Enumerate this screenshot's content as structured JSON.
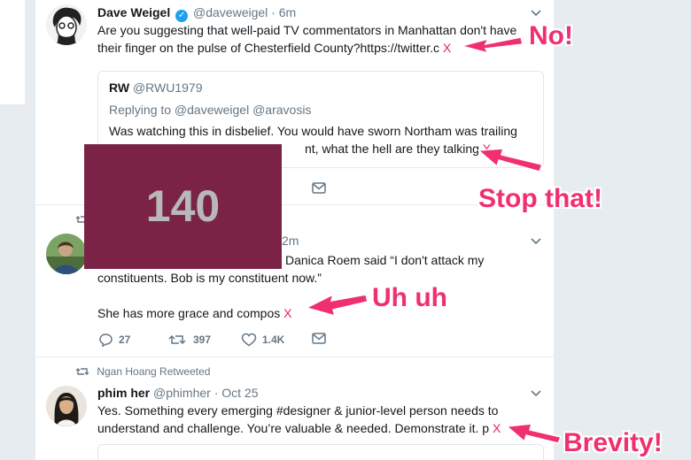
{
  "tweets": [
    {
      "name": "Dave Weigel",
      "handle": "@daveweigel",
      "time": "6m",
      "line1": "Are you suggesting that well-paid TV commentators in Manhattan don't have",
      "line2": "their finger on the pulse of Chesterfield County?https://twitter.c",
      "x": "X",
      "quote": {
        "name": "RW",
        "handle": "@RWU1979",
        "replying": "Replying to @daveweigel @aravosis",
        "line1": "Was watching this in disbelief. You would have sworn Northam was trailing",
        "line2_tail": "nt, what the hell are they talking",
        "x": "X"
      }
    },
    {
      "time_partial": "2m",
      "line1_tail": "Danica Roem said “I don't attack my",
      "line2": "constituents. Bob is my constituent now.”",
      "line3": "She has more grace and compos",
      "x": "X",
      "replies": "27",
      "retweets": "397",
      "likes": "1.4K"
    },
    {
      "context": "Ngan Hoang Retweeted",
      "name": "phim her",
      "handle": "@phimher",
      "time": "Oct 25",
      "line1": "Yes. Something every emerging #designer & junior-level person needs to",
      "line2": "understand and challenge. You’re valuable & needed. Demonstrate it. p",
      "x": "X"
    }
  ],
  "counter": "140",
  "annotations": {
    "a1": "No!",
    "a2": "Stop that!",
    "a3": "Uh uh",
    "a4": "Brevity!"
  },
  "colors": {
    "annotation": "#f0306e",
    "counter_bg": "#7b2346",
    "x_mark": "#e0245e",
    "verified": "#1da1f2"
  }
}
